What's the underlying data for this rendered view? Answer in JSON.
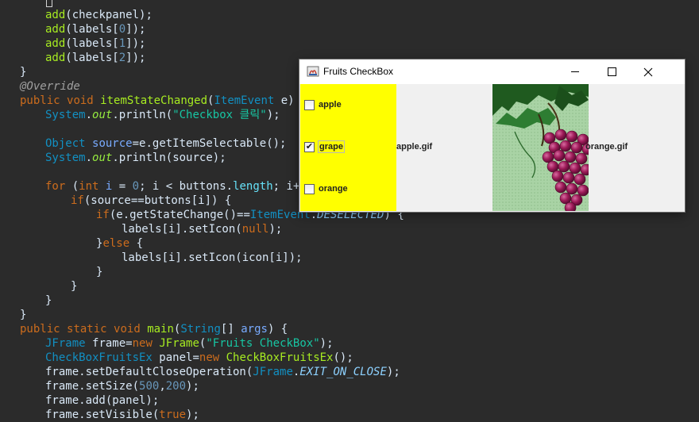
{
  "editor": {
    "lines": [
      [
        {
          "t": "add",
          "c": "fn"
        },
        {
          "t": "(checkpanel);",
          "c": "plain"
        }
      ],
      [
        {
          "t": "add",
          "c": "fn"
        },
        {
          "t": "(labels[",
          "c": "plain"
        },
        {
          "t": "0",
          "c": "num"
        },
        {
          "t": "]);",
          "c": "plain"
        }
      ],
      [
        {
          "t": "add",
          "c": "fn"
        },
        {
          "t": "(labels[",
          "c": "plain"
        },
        {
          "t": "1",
          "c": "num"
        },
        {
          "t": "]);",
          "c": "plain"
        }
      ],
      [
        {
          "t": "add",
          "c": "fn"
        },
        {
          "t": "(labels[",
          "c": "plain"
        },
        {
          "t": "2",
          "c": "num"
        },
        {
          "t": "]);",
          "c": "plain"
        }
      ],
      [
        {
          "t": "}",
          "c": "plain"
        }
      ],
      [
        {
          "t": "@Override",
          "c": "ann"
        }
      ],
      [
        {
          "t": "public",
          "c": "kw"
        },
        {
          "t": " ",
          "c": "plain"
        },
        {
          "t": "void",
          "c": "kw"
        },
        {
          "t": " ",
          "c": "plain"
        },
        {
          "t": "itemStateChanged",
          "c": "fn"
        },
        {
          "t": "(",
          "c": "plain"
        },
        {
          "t": "ItemEvent",
          "c": "type"
        },
        {
          "t": " e) {",
          "c": "plain"
        }
      ],
      [
        {
          "t": "System",
          "c": "type"
        },
        {
          "t": ".",
          "c": "plain"
        },
        {
          "t": "out",
          "c": "static"
        },
        {
          "t": ".",
          "c": "plain"
        },
        {
          "t": "println",
          "c": "plain"
        },
        {
          "t": "(",
          "c": "plain"
        },
        {
          "t": "\"Checkbox 클릭\"",
          "c": "str"
        },
        {
          "t": ");",
          "c": "plain"
        }
      ],
      [],
      [
        {
          "t": "Object",
          "c": "type"
        },
        {
          "t": " ",
          "c": "plain"
        },
        {
          "t": "source",
          "c": "var"
        },
        {
          "t": "=e.",
          "c": "plain"
        },
        {
          "t": "getItemSelectable",
          "c": "plain"
        },
        {
          "t": "();",
          "c": "plain"
        }
      ],
      [
        {
          "t": "System",
          "c": "type"
        },
        {
          "t": ".",
          "c": "plain"
        },
        {
          "t": "out",
          "c": "static"
        },
        {
          "t": ".",
          "c": "plain"
        },
        {
          "t": "println",
          "c": "plain"
        },
        {
          "t": "(source);",
          "c": "plain"
        }
      ],
      [],
      [
        {
          "t": "for",
          "c": "kw"
        },
        {
          "t": " (",
          "c": "plain"
        },
        {
          "t": "int",
          "c": "kw"
        },
        {
          "t": " ",
          "c": "plain"
        },
        {
          "t": "i",
          "c": "var"
        },
        {
          "t": " = ",
          "c": "plain"
        },
        {
          "t": "0",
          "c": "num"
        },
        {
          "t": "; i < buttons.",
          "c": "plain"
        },
        {
          "t": "length",
          "c": "field"
        },
        {
          "t": "; i++)",
          "c": "plain"
        }
      ],
      [
        {
          "t": "if",
          "c": "kw"
        },
        {
          "t": "(source==buttons[i]) {",
          "c": "plain"
        }
      ],
      [
        {
          "t": "if",
          "c": "kw"
        },
        {
          "t": "(e.",
          "c": "plain"
        },
        {
          "t": "getStateChange",
          "c": "plain"
        },
        {
          "t": "()==",
          "c": "plain"
        },
        {
          "t": "ItemEvent",
          "c": "type"
        },
        {
          "t": ".",
          "c": "plain"
        },
        {
          "t": "DESELECTED",
          "c": "cst"
        },
        {
          "t": ") {",
          "c": "plain"
        }
      ],
      [
        {
          "t": "labels[i].setIcon(",
          "c": "plain"
        },
        {
          "t": "null",
          "c": "kw"
        },
        {
          "t": ");",
          "c": "plain"
        }
      ],
      [
        {
          "t": "}",
          "c": "plain"
        },
        {
          "t": "else",
          "c": "kw"
        },
        {
          "t": " {",
          "c": "plain"
        }
      ],
      [
        {
          "t": "labels[i].setIcon(icon[i]);",
          "c": "plain"
        }
      ],
      [
        {
          "t": "}",
          "c": "plain"
        }
      ],
      [
        {
          "t": "}",
          "c": "plain"
        }
      ],
      [
        {
          "t": "}",
          "c": "plain"
        }
      ],
      [
        {
          "t": "}",
          "c": "plain"
        }
      ],
      [
        {
          "t": "public",
          "c": "kw"
        },
        {
          "t": " ",
          "c": "plain"
        },
        {
          "t": "static",
          "c": "kw"
        },
        {
          "t": " ",
          "c": "plain"
        },
        {
          "t": "void",
          "c": "kw"
        },
        {
          "t": " ",
          "c": "plain"
        },
        {
          "t": "main",
          "c": "fn"
        },
        {
          "t": "(",
          "c": "plain"
        },
        {
          "t": "String",
          "c": "type"
        },
        {
          "t": "[] ",
          "c": "plain"
        },
        {
          "t": "args",
          "c": "var"
        },
        {
          "t": ") {",
          "c": "plain"
        }
      ],
      [
        {
          "t": "JFrame",
          "c": "type"
        },
        {
          "t": " ",
          "c": "plain"
        },
        {
          "t": "frame",
          "c": "plain"
        },
        {
          "t": "=",
          "c": "plain"
        },
        {
          "t": "new",
          "c": "kw"
        },
        {
          "t": " ",
          "c": "plain"
        },
        {
          "t": "JFrame",
          "c": "fn"
        },
        {
          "t": "(",
          "c": "plain"
        },
        {
          "t": "\"Fruits CheckBox\"",
          "c": "str"
        },
        {
          "t": ");",
          "c": "plain"
        }
      ],
      [
        {
          "t": "CheckBoxFruitsEx",
          "c": "type"
        },
        {
          "t": " ",
          "c": "plain"
        },
        {
          "t": "panel",
          "c": "plain"
        },
        {
          "t": "=",
          "c": "plain"
        },
        {
          "t": "new",
          "c": "kw"
        },
        {
          "t": " ",
          "c": "plain"
        },
        {
          "t": "CheckBoxFruitsEx",
          "c": "fn"
        },
        {
          "t": "();",
          "c": "plain"
        }
      ],
      [
        {
          "t": "frame.setDefaultCloseOperation(",
          "c": "plain"
        },
        {
          "t": "JFrame",
          "c": "type"
        },
        {
          "t": ".",
          "c": "plain"
        },
        {
          "t": "EXIT_ON_CLOSE",
          "c": "cst"
        },
        {
          "t": ");",
          "c": "plain"
        }
      ],
      [
        {
          "t": "frame.setSize(",
          "c": "plain"
        },
        {
          "t": "500",
          "c": "num"
        },
        {
          "t": ",",
          "c": "plain"
        },
        {
          "t": "200",
          "c": "num"
        },
        {
          "t": ");",
          "c": "plain"
        }
      ],
      [
        {
          "t": "frame.add(panel);",
          "c": "plain"
        }
      ],
      [
        {
          "t": "frame.setVisible(",
          "c": "plain"
        },
        {
          "t": "true",
          "c": "kw"
        },
        {
          "t": ");",
          "c": "plain"
        }
      ]
    ]
  },
  "window": {
    "title": "Fruits CheckBox",
    "minimize_icon": "minimize-icon",
    "maximize_icon": "maximize-icon",
    "close_icon": "close-icon",
    "checkboxes": [
      {
        "label": "apple",
        "checked": false
      },
      {
        "label": "grape",
        "checked": true
      },
      {
        "label": "orange",
        "checked": false
      }
    ],
    "check_mark": "✔",
    "labels": {
      "apple": "apple.gif",
      "orange": "orange.gif"
    },
    "colors": {
      "checkpanel": "#ffff00",
      "grape_bg": "#a3cfa0",
      "grape_fruit": "#9c1a57",
      "leaf": "#1f5a1f"
    }
  }
}
